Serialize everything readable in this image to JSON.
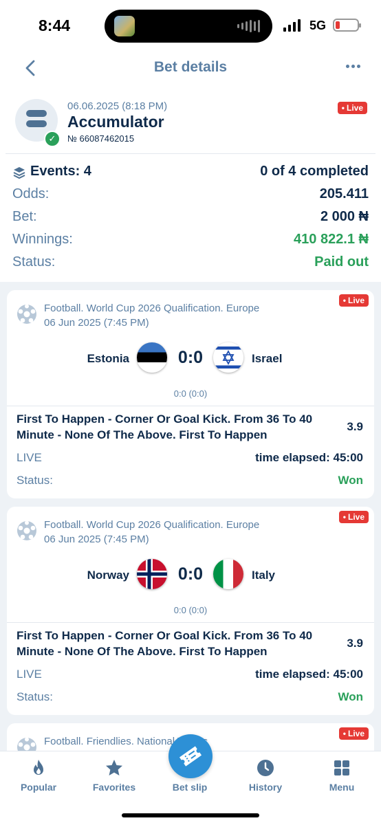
{
  "status_bar": {
    "time": "8:44",
    "network": "5G"
  },
  "header": {
    "title": "Bet details"
  },
  "summary": {
    "date": "06.06.2025 (8:18 PM)",
    "type": "Accumulator",
    "number": "№ 66087462015",
    "live_badge": "Live",
    "events_label": "Events: 4",
    "completed": "0 of 4 completed",
    "odds_label": "Odds:",
    "odds_value": "205.411",
    "bet_label": "Bet:",
    "bet_value": "2 000 ₦",
    "winnings_label": "Winnings:",
    "winnings_value": "410 822.1 ₦",
    "status_label": "Status:",
    "status_value": "Paid out"
  },
  "events": [
    {
      "competition": "Football. World Cup 2026 Qualification. Europe",
      "datetime": "06 Jun 2025 (7:45 PM)",
      "live_badge": "Live",
      "team_home": "Estonia",
      "team_away": "Israel",
      "score": "0:0",
      "halftime": "0:0 (0:0)",
      "market": "First To Happen - Corner Or Goal Kick. From 36 To 40 Minute - None Of The Above. First To Happen",
      "coefficient": "3.9",
      "live_label": "LIVE",
      "elapsed": "time elapsed: 45:00",
      "status_label": "Status:",
      "status_value": "Won"
    },
    {
      "competition": "Football. World Cup 2026 Qualification. Europe",
      "datetime": "06 Jun 2025 (7:45 PM)",
      "live_badge": "Live",
      "team_home": "Norway",
      "team_away": "Italy",
      "score": "0:0",
      "halftime": "0:0 (0:0)",
      "market": "First To Happen - Corner Or Goal Kick. From 36 To 40 Minute - None Of The Above. First To Happen",
      "coefficient": "3.9",
      "live_label": "LIVE",
      "elapsed": "time elapsed: 45:00",
      "status_label": "Status:",
      "status_value": "Won"
    },
    {
      "competition": "Football. Friendlies. National Teams",
      "live_badge": "Live"
    }
  ],
  "bottom_nav": [
    {
      "label": "Popular",
      "icon": "flame-icon"
    },
    {
      "label": "Favorites",
      "icon": "star-icon"
    },
    {
      "label": "Bet slip",
      "icon": "ticket-icon"
    },
    {
      "label": "History",
      "icon": "clock-icon"
    },
    {
      "label": "Menu",
      "icon": "grid-icon"
    }
  ],
  "colors": {
    "accent": "#2d90d6",
    "text_dark": "#0f2a4a",
    "text_muted": "#5b7fa3",
    "success": "#2aa05a",
    "live": "#e53935"
  }
}
